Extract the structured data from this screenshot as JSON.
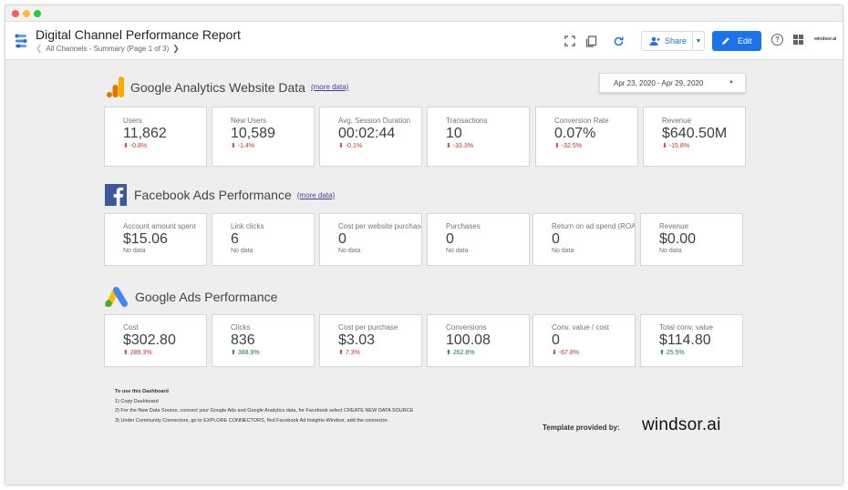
{
  "report": {
    "title": "Digital Channel Performance Report",
    "page_label": "All Channels - Summary (Page 1 of 3)"
  },
  "toolbar": {
    "share_label": "Share",
    "edit_label": "Edit",
    "brand_mini": "windsor.ai"
  },
  "date_range": "Apr 23, 2020 - Apr 29, 2020",
  "colors": {
    "accent": "#1a73e8",
    "negative": "#d93025",
    "positive": "#188038"
  },
  "sections": {
    "ga": {
      "title": "Google Analytics Website Data",
      "link": "(more data)",
      "icon": "google-analytics-icon",
      "metrics": [
        {
          "label": "Users",
          "value": "11,862",
          "delta": "-0.8%",
          "trend": "down"
        },
        {
          "label": "New Users",
          "value": "10,589",
          "delta": "-1.4%",
          "trend": "down"
        },
        {
          "label": "Avg. Session Duration",
          "value": "00:02:44",
          "delta": "-0.1%",
          "trend": "down"
        },
        {
          "label": "Transactions",
          "value": "10",
          "delta": "-33.3%",
          "trend": "down"
        },
        {
          "label": "Conversion Rate",
          "value": "0.07%",
          "delta": "-32.5%",
          "trend": "down"
        },
        {
          "label": "Revenue",
          "value": "$640.50M",
          "delta": "-15.8%",
          "trend": "down"
        }
      ]
    },
    "fb": {
      "title": "Facebook Ads Performance",
      "link": "(more data)",
      "icon": "facebook-icon",
      "metrics": [
        {
          "label": "Account amount spent",
          "value": "$15.06",
          "delta": "No data",
          "trend": "none"
        },
        {
          "label": "Link clicks",
          "value": "6",
          "delta": "No data",
          "trend": "none"
        },
        {
          "label": "Cost per website purchase",
          "value": "0",
          "delta": "No data",
          "trend": "none"
        },
        {
          "label": "Purchases",
          "value": "0",
          "delta": "No data",
          "trend": "none"
        },
        {
          "label": "Return on ad spend (ROAS",
          "value": "0",
          "delta": "No data",
          "trend": "none"
        },
        {
          "label": "Revenue",
          "value": "$0.00",
          "delta": "No data",
          "trend": "none"
        }
      ]
    },
    "gads": {
      "title": "Google Ads Performance",
      "icon": "google-ads-icon",
      "metrics": [
        {
          "label": "Cost",
          "value": "$302.80",
          "delta": "289.3%",
          "trend": "up-bad"
        },
        {
          "label": "Clicks",
          "value": "836",
          "delta": "388.9%",
          "trend": "up"
        },
        {
          "label": "Cost per purchase",
          "value": "$3.03",
          "delta": "7.3%",
          "trend": "up-bad"
        },
        {
          "label": "Conversions",
          "value": "100.08",
          "delta": "262.8%",
          "trend": "up"
        },
        {
          "label": "Conv. value / cost",
          "value": "0",
          "delta": "-67.8%",
          "trend": "down"
        },
        {
          "label": "Total conv. value",
          "value": "$114.80",
          "delta": "25.5%",
          "trend": "up"
        }
      ]
    }
  },
  "instructions": {
    "title": "To use this Dashboard",
    "steps": [
      "1) Copy Dashboard",
      "2) For the New Data Source, connect your Google Ads and Google Analytics data, for Facebook select CREATE NEW DATA SOURCE",
      "3) Under Community Connectors, go to EXPLORE CONNECTORS, find Facebook Ad Insights-Windsor, add the connector."
    ]
  },
  "footer": {
    "provided_by": "Template provided by:",
    "brand": "windsor.ai"
  }
}
